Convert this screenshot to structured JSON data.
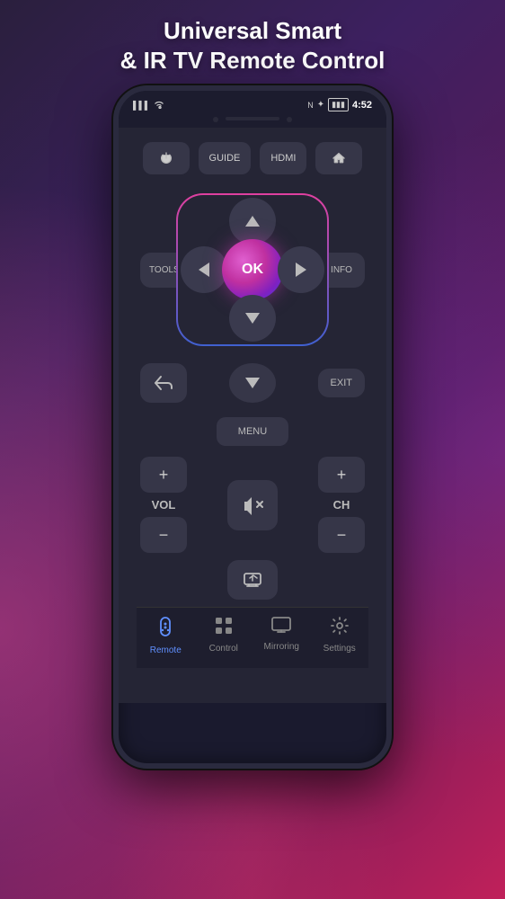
{
  "page": {
    "title_line1": "Universal Smart",
    "title_line2": "& IR TV Remote Control"
  },
  "status_bar": {
    "time": "4:52",
    "left_icons": [
      "signal",
      "wifi"
    ],
    "right_icons": [
      "nfc",
      "bluetooth",
      "battery"
    ]
  },
  "top_buttons": [
    {
      "id": "power",
      "type": "icon",
      "label": ""
    },
    {
      "id": "guide",
      "type": "text",
      "label": "GUIDE"
    },
    {
      "id": "hdmi",
      "type": "text",
      "label": "HDMI"
    },
    {
      "id": "home",
      "type": "icon",
      "label": ""
    }
  ],
  "nav_labels": {
    "tools": "TOOLS",
    "info": "INFO"
  },
  "dpad": {
    "ok_label": "OK",
    "arrows": [
      "up",
      "left",
      "right",
      "down"
    ]
  },
  "below_nav": {
    "back_symbol": "↩",
    "exit_label": "EXIT"
  },
  "menu_label": "MENU",
  "volume": {
    "plus": "+",
    "label": "VOL",
    "minus": "−"
  },
  "channel": {
    "plus": "+",
    "label": "CH",
    "minus": "−"
  },
  "bottom_nav": [
    {
      "id": "remote",
      "label": "Remote",
      "active": true
    },
    {
      "id": "control",
      "label": "Control",
      "active": false
    },
    {
      "id": "mirroring",
      "label": "Mirroring",
      "active": false
    },
    {
      "id": "settings",
      "label": "Settings",
      "active": false
    }
  ]
}
